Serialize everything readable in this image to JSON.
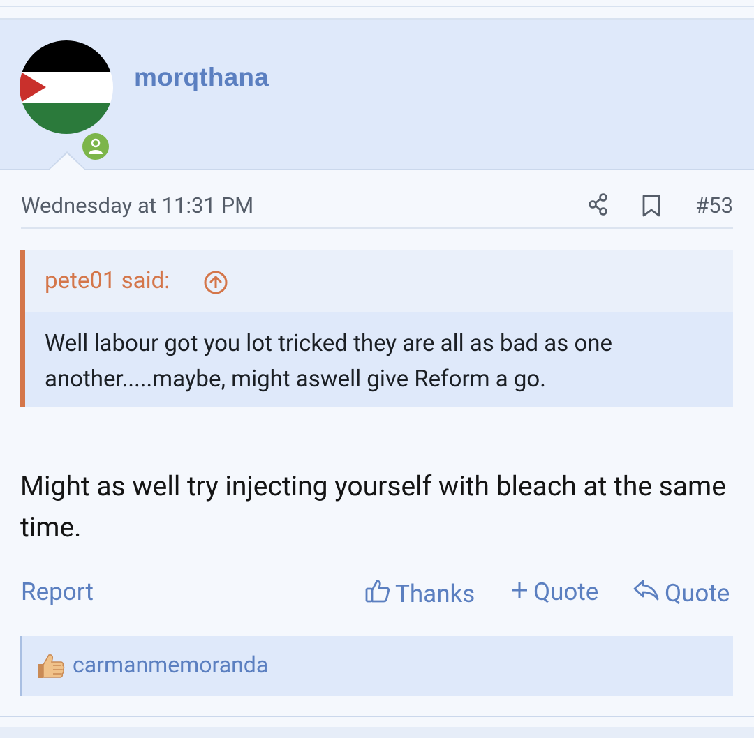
{
  "post": {
    "username": "morqthana",
    "timestamp": "Wednesday at 11:31 PM",
    "post_number": "#53",
    "quote": {
      "author": "pete01 said:",
      "text": "Well labour got you lot tricked they are all as bad as one another.....maybe, might aswell give Reform a go."
    },
    "message": "Might as well try injecting yourself with bleach at the same time.",
    "actions": {
      "report": "Report",
      "thanks": "Thanks",
      "multi_quote": "Quote",
      "reply_quote": "Quote"
    },
    "reactions": {
      "user": "carmanmemoranda"
    }
  },
  "icons": {
    "avatar": "palestine-flag-avatar",
    "online": "user-online-icon",
    "share": "share-icon",
    "bookmark": "bookmark-icon",
    "quote_jump": "arrow-up-circle-icon",
    "thanks": "thumbs-up-outline-icon",
    "multi_quote": "plus-icon",
    "reply": "reply-arrow-icon",
    "reaction": "thumbs-up-emoji-icon"
  },
  "colors": {
    "accent": "#5b7fc0",
    "quote_accent": "#d4764a",
    "header_bg": "#dfe9fa",
    "online": "#7cb54a"
  }
}
